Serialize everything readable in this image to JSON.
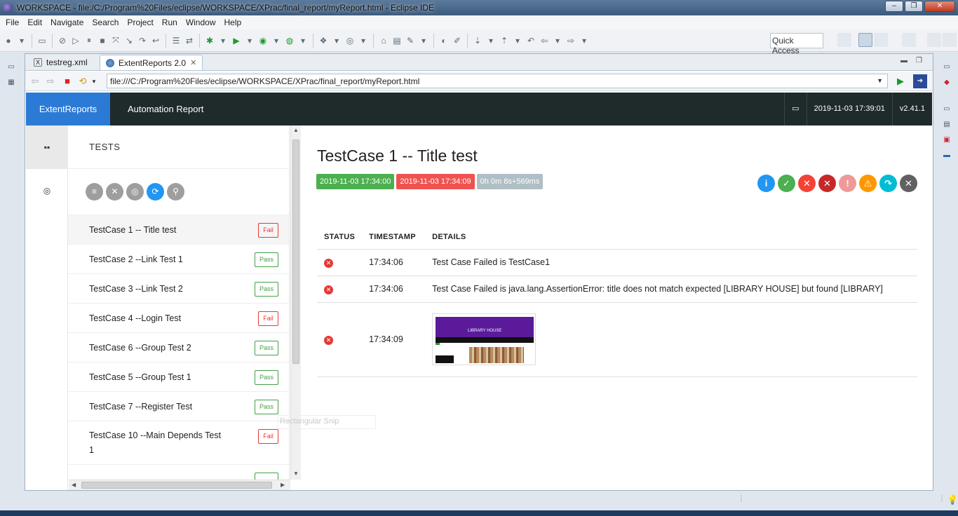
{
  "window": {
    "title": "WORKSPACE - file:/C:/Program%20Files/eclipse/WORKSPACE/XPrac/final_report/myReport.html - Eclipse IDE",
    "minimize": "–",
    "maximize": "❐",
    "close": "✕"
  },
  "menu": [
    "File",
    "Edit",
    "Navigate",
    "Search",
    "Project",
    "Run",
    "Window",
    "Help"
  ],
  "toolbar": {
    "quick_access": "Quick Access"
  },
  "editor_tabs": [
    {
      "label": "testreg.xml"
    },
    {
      "label": "ExtentReports 2.0",
      "close": "✕"
    }
  ],
  "browser": {
    "url": "file:///C:/Program%20Files/eclipse/WORKSPACE/XPrac/final_report/myReport.html"
  },
  "report": {
    "brand": "ExtentReports",
    "title": "Automation Report",
    "datetime": "2019-11-03 17:39:01",
    "version": "v2.41.1",
    "tests_heading": "TESTS",
    "tests": [
      {
        "name": "TestCase 1 -- Title test",
        "status": "Fail"
      },
      {
        "name": "TestCase 2 --Link Test 1",
        "status": "Pass"
      },
      {
        "name": "TestCase 3 --Link Test 2",
        "status": "Pass"
      },
      {
        "name": "TestCase 4 --Login Test",
        "status": "Fail"
      },
      {
        "name": "TestCase 6 --Group Test 2",
        "status": "Pass"
      },
      {
        "name": "TestCase 5 --Group Test 1",
        "status": "Pass"
      },
      {
        "name": "TestCase 7 --Register Test",
        "status": "Pass"
      },
      {
        "name": "TestCase 10 --Main Depends Test 1",
        "status": "Fail"
      }
    ],
    "detail": {
      "title": "TestCase 1 -- Title test",
      "start": "2019-11-03 17:34:00",
      "end": "2019-11-03 17:34:09",
      "duration": "0h 0m 8s+569ms",
      "columns": [
        "STATUS",
        "TIMESTAMP",
        "DETAILS"
      ],
      "logs": [
        {
          "time": "17:34:06",
          "details": "Test Case Failed is TestCase1"
        },
        {
          "time": "17:34:06",
          "details": "Test Case Failed is java.lang.AssertionError: title does not match expected [LIBRARY HOUSE] but found [LIBRARY]"
        },
        {
          "time": "17:34:09",
          "details": ""
        }
      ],
      "screenshot_heading": "LIBRARY HOUSE"
    },
    "status_filter_colors": [
      "#2196f3",
      "#4caf50",
      "#f44336",
      "#c62828",
      "#ef9a9a",
      "#ff9800",
      "#00bcd4",
      "#616161"
    ]
  },
  "overlay": {
    "snip_label": "Rectangular Snip"
  }
}
